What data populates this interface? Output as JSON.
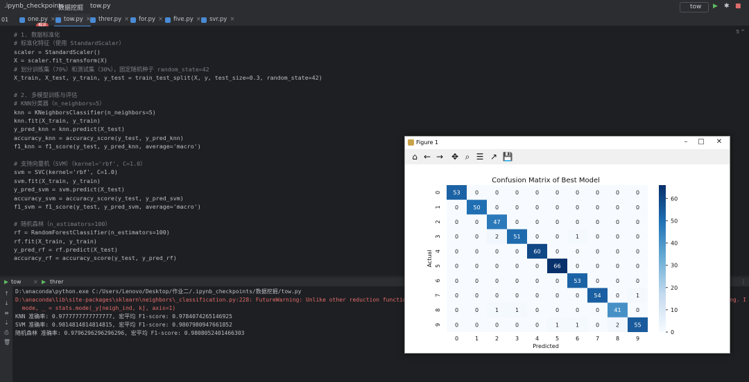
{
  "titlebar": {
    "path": ".ipynb_checkpoints",
    "folder": "数据挖掘",
    "file": "tow.py",
    "run_config": "tow"
  },
  "tabs": [
    {
      "label": "one.py"
    },
    {
      "label": "tow.py"
    },
    {
      "label": "threr.py"
    },
    {
      "label": "for.py"
    },
    {
      "label": "five.py"
    },
    {
      "label": "svr.py"
    }
  ],
  "badge": "推送",
  "editor": {
    "lines": [
      {
        "text": "# 1. 数据标准化",
        "kind": "comment"
      },
      {
        "text": "# 标准化特征（使用 StandardScaler）",
        "kind": "comment"
      },
      {
        "text": "scaler = StandardScaler()",
        "kind": "code"
      },
      {
        "text": "X = scaler.fit_transform(X)",
        "kind": "code"
      },
      {
        "text": "# 划分训练集（70%）和测试集（30%），固定随机种子 random_state=42",
        "kind": "comment"
      },
      {
        "text": "X_train, X_test, y_train, y_test = train_test_split(X, y, test_size=0.3, random_state=42)",
        "kind": "code"
      },
      {
        "text": "",
        "kind": "code"
      },
      {
        "text": "# 2. 多模型训练与评估",
        "kind": "comment"
      },
      {
        "text": "# KNN分类器（n_neighbors=5）",
        "kind": "comment"
      },
      {
        "text": "knn = KNeighborsClassifier(n_neighbors=5)",
        "kind": "code"
      },
      {
        "text": "knn.fit(X_train, y_train)",
        "kind": "code"
      },
      {
        "text": "y_pred_knn = knn.predict(X_test)",
        "kind": "code"
      },
      {
        "text": "accuracy_knn = accuracy_score(y_test, y_pred_knn)",
        "kind": "code"
      },
      {
        "text": "f1_knn = f1_score(y_test, y_pred_knn, average='macro')",
        "kind": "code"
      },
      {
        "text": "",
        "kind": "code"
      },
      {
        "text": "# 支持向量机（SVM）（kernel='rbf', C=1.0）",
        "kind": "comment"
      },
      {
        "text": "svm = SVC(kernel='rbf', C=1.0)",
        "kind": "code"
      },
      {
        "text": "svm.fit(X_train, y_train)",
        "kind": "code"
      },
      {
        "text": "y_pred_svm = svm.predict(X_test)",
        "kind": "code"
      },
      {
        "text": "accuracy_svm = accuracy_score(y_test, y_pred_svm)",
        "kind": "code"
      },
      {
        "text": "f1_svm = f1_score(y_test, y_pred_svm, average='macro')",
        "kind": "code"
      },
      {
        "text": "",
        "kind": "code"
      },
      {
        "text": "# 随机森林（n_estimators=100）",
        "kind": "comment"
      },
      {
        "text": "rf = RandomForestClassifier(n_estimators=100)",
        "kind": "code"
      },
      {
        "text": "rf.fit(X_train, y_train)",
        "kind": "code"
      },
      {
        "text": "y_pred_rf = rf.predict(X_test)",
        "kind": "code"
      },
      {
        "text": "accuracy_rf = accuracy_score(y_test, y_pred_rf)",
        "kind": "code"
      }
    ]
  },
  "gutter_line": "01",
  "hint": "5 ^",
  "run_tabs": [
    {
      "label": "tow"
    },
    {
      "label": "threr"
    }
  ],
  "console": {
    "lines": [
      {
        "text": "D:\\anaconda\\python.exe C:/Users/Lenovo/Desktop/作业二/.ipynb_checkpoints/数据挖掘/tow.py",
        "kind": "plain"
      },
      {
        "text": "D:\\anaconda\\lib\\site-packages\\sklearn\\neighbors\\_classification.py:228: FutureWarning: Unlike other reduction functions",
        "kind": "warn"
      },
      {
        "text": "  mode, _ = stats.mode(_y[neigh_ind, k], axis=1)",
        "kind": "red"
      },
      {
        "text": "KNN 准确率: 0.9777777777777777, 宏平均 F1-score: 0.9784074265146925",
        "kind": "plain"
      },
      {
        "text": "SVM 准确率: 0.9814814814814815, 宏平均 F1-score: 0.9807980947661852",
        "kind": "plain"
      },
      {
        "text": "随机森林 准确率: 0.9796296296296296, 宏平均 F1-score: 0.9808052401466303",
        "kind": "plain"
      }
    ],
    "overflow_tail": "ng. I"
  },
  "figure": {
    "window_title": "Figure 1"
  },
  "chart_data": {
    "type": "heatmap",
    "title": "Confusion Matrix of Best Model",
    "xlabel": "Predicted",
    "ylabel": "Actual",
    "x_ticks": [
      "0",
      "1",
      "2",
      "3",
      "4",
      "5",
      "6",
      "7",
      "8",
      "9"
    ],
    "y_ticks": [
      "0",
      "1",
      "2",
      "3",
      "4",
      "5",
      "6",
      "7",
      "8",
      "9"
    ],
    "matrix": [
      [
        53,
        0,
        0,
        0,
        0,
        0,
        0,
        0,
        0,
        0
      ],
      [
        0,
        50,
        0,
        0,
        0,
        0,
        0,
        0,
        0,
        0
      ],
      [
        0,
        0,
        47,
        0,
        0,
        0,
        0,
        0,
        0,
        0
      ],
      [
        0,
        0,
        2,
        51,
        0,
        0,
        1,
        0,
        0,
        0
      ],
      [
        0,
        0,
        0,
        0,
        60,
        0,
        0,
        0,
        0,
        0
      ],
      [
        0,
        0,
        0,
        0,
        0,
        66,
        0,
        0,
        0,
        0
      ],
      [
        0,
        0,
        0,
        0,
        0,
        0,
        53,
        0,
        0,
        0
      ],
      [
        0,
        0,
        0,
        0,
        0,
        0,
        0,
        54,
        0,
        1
      ],
      [
        0,
        0,
        1,
        1,
        0,
        0,
        0,
        0,
        41,
        0
      ],
      [
        0,
        0,
        0,
        0,
        0,
        1,
        1,
        0,
        2,
        55
      ]
    ],
    "colorbar_ticks": [
      0,
      10,
      20,
      30,
      40,
      50,
      60
    ],
    "vmin": 0,
    "vmax": 66,
    "colormap": "Blues"
  }
}
